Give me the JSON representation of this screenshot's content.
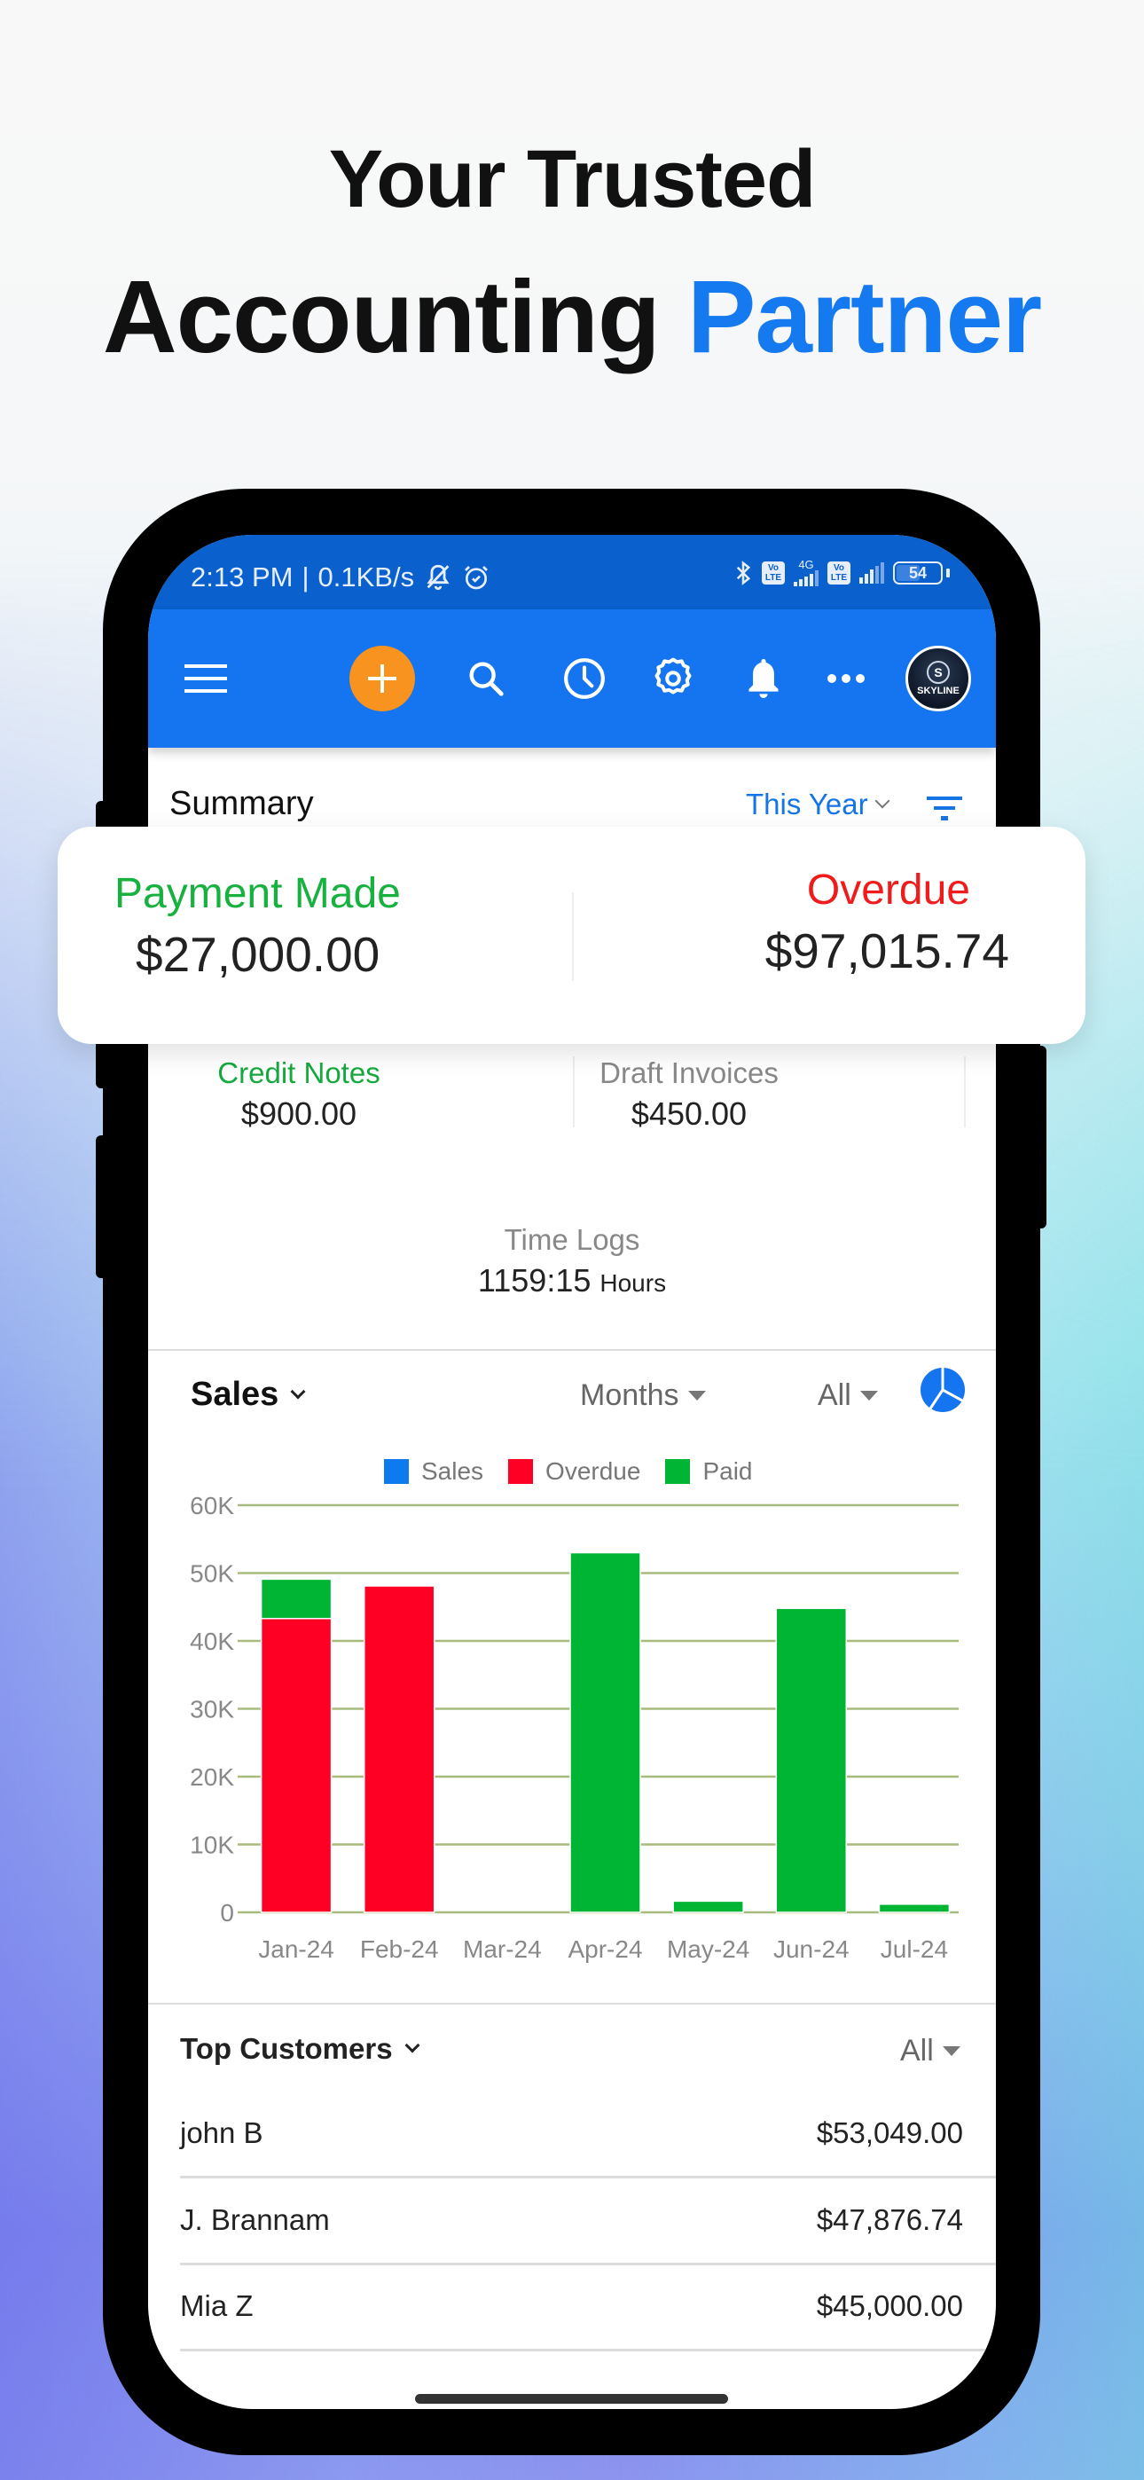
{
  "headline": {
    "line1": "Your Trusted",
    "line2_main": "Accounting",
    "line2_accent": "Partner"
  },
  "colors": {
    "brand_blue": "#1574ef",
    "status_bar": "#0a60cc",
    "accent_orange": "#f7931e",
    "paid_green": "#00b533",
    "overdue_red": "#ff0025",
    "sales_blue": "#0e7af0",
    "gridline": "#a8bb7f"
  },
  "status_bar": {
    "time": "2:13 PM",
    "net_speed": "0.1KB/s",
    "network_1": "4G",
    "volte_label_top": "Vo",
    "volte_label_bottom": "LTE",
    "battery": "54"
  },
  "toolbar": {
    "icons": [
      "menu-icon",
      "add-icon",
      "search-icon",
      "clock-icon",
      "settings-icon",
      "bell-icon",
      "more-icon",
      "avatar"
    ],
    "avatar_text": "SKYLINE",
    "avatar_letter": "S"
  },
  "summary": {
    "title": "Summary",
    "period": "This Year",
    "payment_made_label": "Payment Made",
    "payment_made_value": "$27,000.00",
    "overdue_label": "Overdue",
    "overdue_value": "$97,015.74",
    "credit_notes_label": "Credit Notes",
    "credit_notes_value": "$900.00",
    "draft_invoices_label": "Draft Invoices",
    "draft_invoices_value": "$450.00",
    "time_logs_label": "Time Logs",
    "time_logs_value": "1159:15",
    "time_logs_unit": "Hours"
  },
  "sales": {
    "title": "Sales",
    "period_dropdown": "Months",
    "filter_dropdown": "All"
  },
  "chart_data": {
    "type": "bar",
    "stacked": true,
    "title": "",
    "xlabel": "",
    "ylabel": "",
    "categories": [
      "Jan-24",
      "Feb-24",
      "Mar-24",
      "Apr-24",
      "May-24",
      "Jun-24",
      "Jul-24"
    ],
    "series": [
      {
        "name": "Sales",
        "color": "#0e7af0",
        "values": [
          0,
          0,
          0,
          0,
          0,
          0,
          0
        ]
      },
      {
        "name": "Overdue",
        "color": "#ff0025",
        "values": [
          43300,
          48100,
          0,
          0,
          0,
          0,
          0
        ]
      },
      {
        "name": "Paid",
        "color": "#00b533",
        "values": [
          5800,
          0,
          0,
          53000,
          1650,
          44800,
          1200
        ]
      }
    ],
    "ylim": [
      0,
      60000
    ],
    "yticks": [
      0,
      10000,
      20000,
      30000,
      40000,
      50000,
      60000
    ],
    "ytick_labels": [
      "0",
      "10K",
      "20K",
      "30K",
      "40K",
      "50K",
      "60K"
    ],
    "grid": true,
    "legend": "top-center"
  },
  "top_customers": {
    "title": "Top Customers",
    "filter": "All",
    "rows": [
      {
        "name": "john B",
        "amount": "$53,049.00"
      },
      {
        "name": "J. Brannam",
        "amount": "$47,876.74"
      },
      {
        "name": "Mia Z",
        "amount": "$45,000.00"
      }
    ]
  }
}
